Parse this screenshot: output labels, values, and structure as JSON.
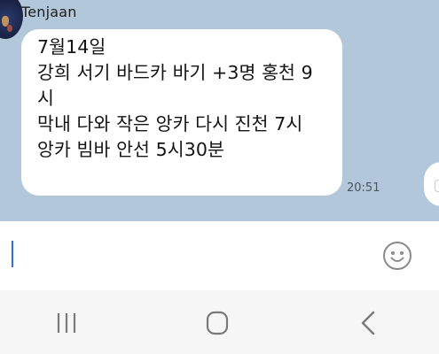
{
  "chat": {
    "sender_name": "Tenjaan",
    "message_lines": [
      "7월14일",
      "강희 서기 바드카 바기  +3명 홍천 9",
      "시",
      "막내 다와 작은 앙카 다시 진천 7시",
      "앙카 빔바 안선 5시30분"
    ],
    "timestamp": "20:51"
  },
  "input": {
    "placeholder": "",
    "value": ""
  },
  "icons": {
    "emoji": "smiley-face-icon",
    "nav_recents": "recent-apps-icon",
    "nav_home": "home-icon",
    "nav_back": "back-chevron-icon"
  },
  "colors": {
    "chat_background": "#b2c7d9",
    "bubble": "#ffffff",
    "caret": "#2f6fd6",
    "nav_icons": "#7a7a7a"
  }
}
